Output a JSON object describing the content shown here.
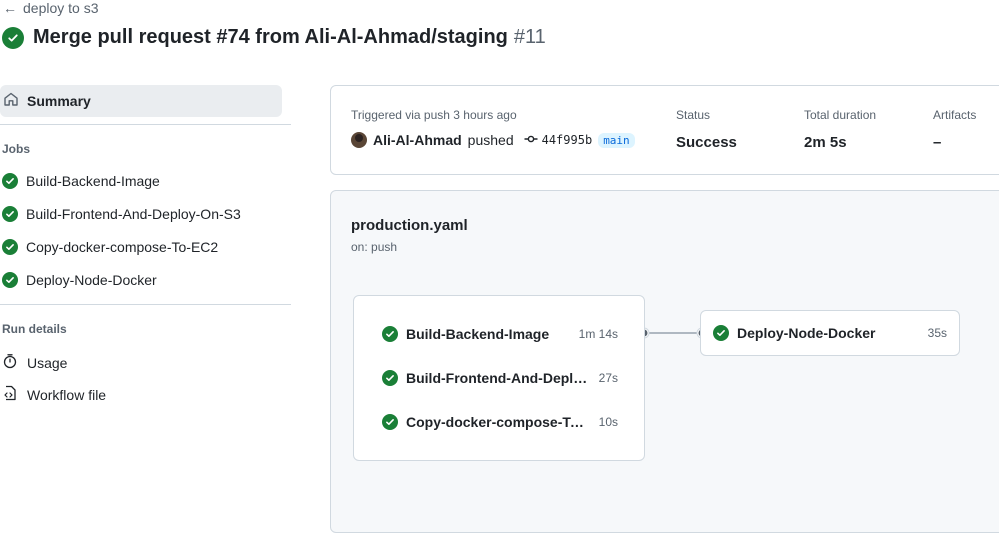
{
  "header": {
    "back_label": "deploy to s3",
    "title": "Merge pull request #74 from Ali-Al-Ahmad/staging",
    "run_number": "#11"
  },
  "sidebar": {
    "summary_label": "Summary",
    "jobs_title": "Jobs",
    "jobs": [
      {
        "label": "Build-Backend-Image"
      },
      {
        "label": "Build-Frontend-And-Deploy-On-S3"
      },
      {
        "label": "Copy-docker-compose-To-EC2"
      },
      {
        "label": "Deploy-Node-Docker"
      }
    ],
    "run_details_title": "Run details",
    "run_details": [
      {
        "label": "Usage",
        "icon": "stopwatch-icon"
      },
      {
        "label": "Workflow file",
        "icon": "file-code-icon"
      }
    ]
  },
  "status_card": {
    "trigger_label": "Triggered via push 3 hours ago",
    "actor": "Ali-Al-Ahmad",
    "action": "pushed",
    "commit": "44f995b",
    "branch": "main",
    "status_label": "Status",
    "status_value": "Success",
    "duration_label": "Total duration",
    "duration_value": "2m 5s",
    "artifacts_label": "Artifacts",
    "artifacts_value": "–"
  },
  "workflow": {
    "file_name": "production.yaml",
    "trigger": "on: push",
    "group_jobs": [
      {
        "name": "Build-Backend-Image",
        "duration": "1m 14s"
      },
      {
        "name": "Build-Frontend-And-Deploy-On-S3",
        "duration": "27s"
      },
      {
        "name": "Copy-docker-compose-To-EC2",
        "duration": "10s"
      }
    ],
    "next_job": {
      "name": "Deploy-Node-Docker",
      "duration": "35s"
    }
  },
  "colors": {
    "success": "#1a7f37",
    "accent": "#0969da",
    "muted_text": "#59636e",
    "border": "#d1d9e0"
  }
}
